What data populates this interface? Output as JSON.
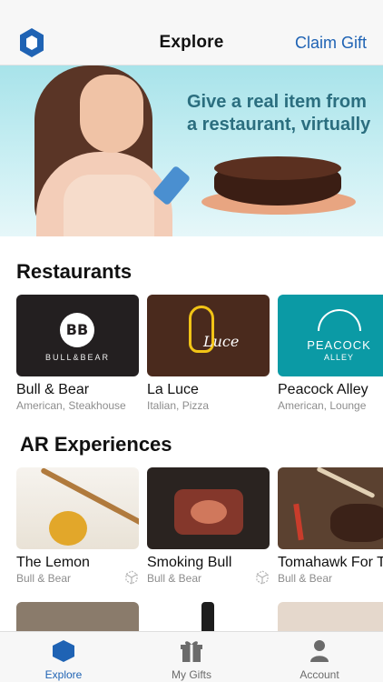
{
  "header": {
    "title": "Explore",
    "claim_label": "Claim Gift",
    "logo_icon": "hexagon-logo-icon"
  },
  "banner": {
    "headline": "Give a real item from a restaurant, virtually"
  },
  "restaurants": {
    "title": "Restaurants",
    "items": [
      {
        "name": "Bull & Bear",
        "cuisine": "American, Steakhouse",
        "logo_text": "BB",
        "logo_caption": "BULL&BEAR"
      },
      {
        "name": "La Luce",
        "cuisine": "Italian, Pizza",
        "logo_text": "Luce"
      },
      {
        "name": "Peacock Alley",
        "cuisine": "American, Lounge",
        "logo_text": "PEACOCK",
        "logo_caption": "ALLEY"
      }
    ]
  },
  "ar": {
    "title": "AR Experiences",
    "items": [
      {
        "name": "The Lemon",
        "restaurant": "Bull & Bear",
        "icon": "ar-cube-icon"
      },
      {
        "name": "Smoking Bull",
        "restaurant": "Bull & Bear",
        "icon": "ar-cube-icon"
      },
      {
        "name": "Tomahawk For T",
        "restaurant": "Bull & Bear"
      }
    ]
  },
  "tabs": [
    {
      "label": "Explore",
      "icon": "hexagon-icon",
      "active": true
    },
    {
      "label": "My Gifts",
      "icon": "gift-icon",
      "active": false
    },
    {
      "label": "Account",
      "icon": "person-icon",
      "active": false
    }
  ],
  "colors": {
    "accent": "#1f63b4",
    "banner_text": "#2b6e7f"
  }
}
